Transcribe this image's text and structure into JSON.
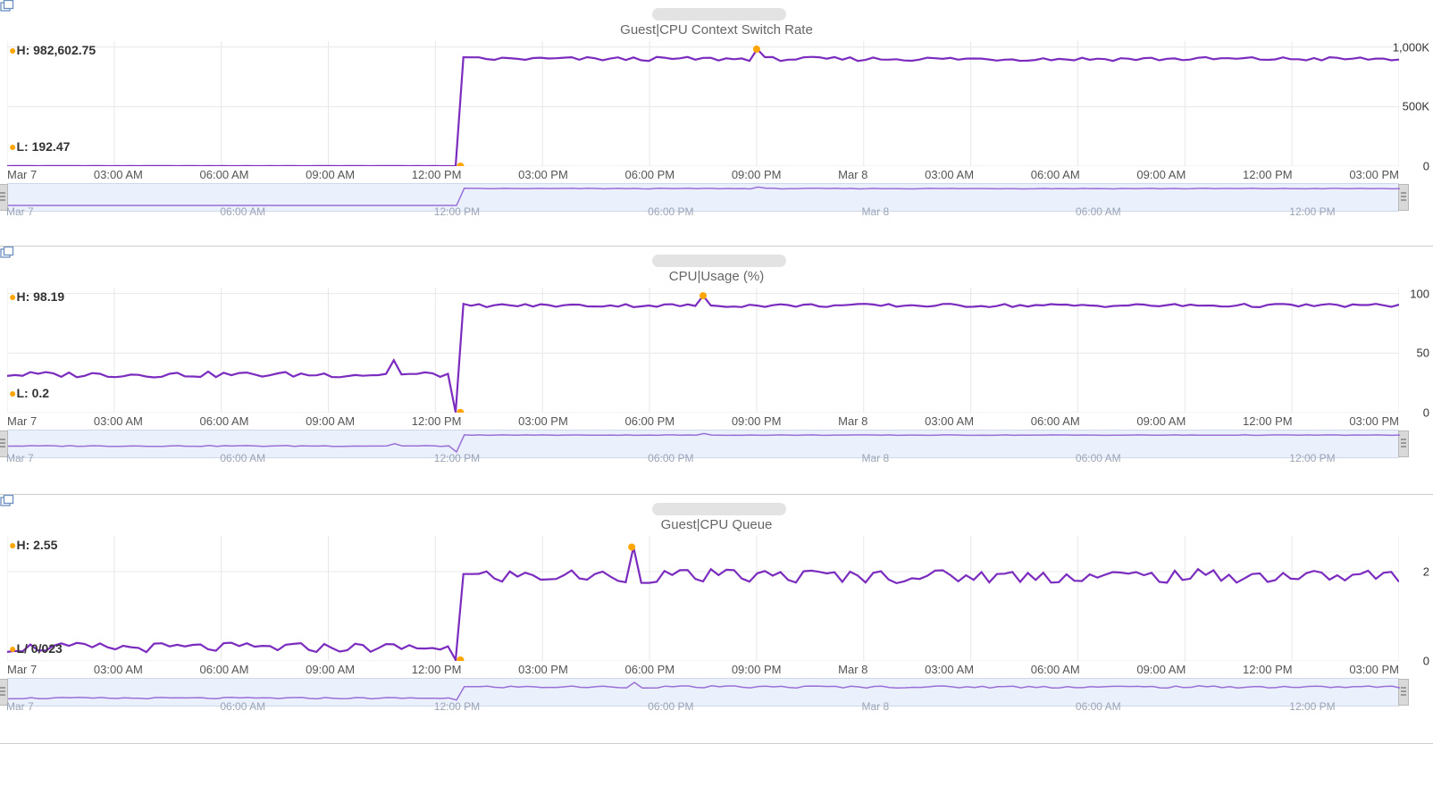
{
  "panels": [
    {
      "hostname": "(redacted)",
      "title": "Guest|CPU Context Switch Rate",
      "high_label": "H: 982,602.75",
      "low_label": "L: 192.47",
      "yticks": [
        {
          "label": "1,000K",
          "v": 1000000
        },
        {
          "label": "500K",
          "v": 500000
        },
        {
          "label": "0",
          "v": 0
        }
      ],
      "ymax": 1050000
    },
    {
      "hostname": "(redacted)",
      "title": "CPU|Usage (%)",
      "high_label": "H: 98.19",
      "low_label": "L: 0.2",
      "yticks": [
        {
          "label": "100",
          "v": 100
        },
        {
          "label": "50",
          "v": 50
        },
        {
          "label": "0",
          "v": 0
        }
      ],
      "ymax": 105
    },
    {
      "hostname": "(redacted)",
      "title": "Guest|CPU Queue",
      "high_label": "H: 2.55",
      "low_label": "L/ 0/023",
      "yticks": [
        {
          "label": "2",
          "v": 2
        },
        {
          "label": "0",
          "v": 0
        }
      ],
      "ymax": 2.8
    }
  ],
  "xticks": [
    "Mar 7",
    "03:00 AM",
    "06:00 AM",
    "09:00 AM",
    "12:00 PM",
    "03:00 PM",
    "06:00 PM",
    "09:00 PM",
    "Mar 8",
    "03:00 AM",
    "06:00 AM",
    "09:00 AM",
    "12:00 PM",
    "03:00 PM"
  ],
  "scrub_ticks": [
    {
      "label": "Mar 7",
      "t": 0
    },
    {
      "label": "06:00 AM",
      "t": 6
    },
    {
      "label": "12:00 PM",
      "t": 12
    },
    {
      "label": "06:00 PM",
      "t": 18
    },
    {
      "label": "Mar 8",
      "t": 24
    },
    {
      "label": "06:00 AM",
      "t": 30
    },
    {
      "label": "12:00 PM",
      "t": 36
    }
  ],
  "chart_data": [
    {
      "type": "line",
      "title": "Guest|CPU Context Switch Rate",
      "ylabel": "",
      "xlabel": "",
      "ylim": [
        0,
        1000000
      ],
      "xunits": "hours since Mar 7 00:00",
      "high": 982602.75,
      "low": 192.47,
      "annotations": {
        "high_point_t": 21,
        "low_point_t": 12.7
      },
      "series": [
        {
          "name": "context_switch_rate",
          "x_values": "0..39 step 0.25",
          "pattern": "≈200 until t≈12.7 (brief dip to 192) then step to ≈900k±30k noise sustained to t=39, peak 982602.75 near t≈21"
        }
      ]
    },
    {
      "type": "line",
      "title": "CPU|Usage (%)",
      "ylabel": "%",
      "xlabel": "",
      "ylim": [
        0,
        100
      ],
      "xunits": "hours since Mar 7 00:00",
      "high": 98.19,
      "low": 0.2,
      "annotations": {
        "high_point_t": 19.5,
        "low_point_t": 12.7
      },
      "series": [
        {
          "name": "cpu_usage_pct",
          "x_values": "0..39 step 0.25",
          "pattern": "≈32±4 noise until t≈12.5, sharp dip to 0.2 at t≈12.7, then step to ≈90±3 sustained to t=39, peak 98.19 near t≈19.5"
        }
      ]
    },
    {
      "type": "line",
      "title": "Guest|CPU Queue",
      "ylabel": "",
      "xlabel": "",
      "ylim": [
        0,
        2.8
      ],
      "xunits": "hours since Mar 7 00:00",
      "high": 2.55,
      "low": 0.023,
      "annotations": {
        "high_point_t": 17.5,
        "low_point_t": 12.7
      },
      "series": [
        {
          "name": "cpu_queue",
          "x_values": "0..39 step 0.25",
          "pattern": "≈0.3±0.2 noise until t≈12.5, dip to 0.023 at t≈12.7, then step to ≈1.9±0.3 noise sustained to t=39, peak 2.55 near t≈17.5"
        }
      ]
    }
  ]
}
